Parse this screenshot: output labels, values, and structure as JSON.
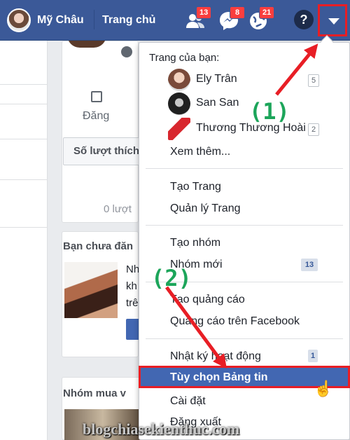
{
  "topbar": {
    "user_name": "Mỹ Châu",
    "home_label": "Trang chủ",
    "friend_requests_count": "13",
    "messages_count": "8",
    "notifications_count": "21",
    "help_glyph": "?",
    "bg_color": "#3b5998"
  },
  "feed": {
    "post_action": "Đăng",
    "stat_button": "Số lượt thích",
    "zero_likes": "0 lượt",
    "suggest_title": "Bạn chưa đăn",
    "suggest_lines": [
      "Nh",
      "kh",
      "trê"
    ],
    "group_title": "Nhóm mua v"
  },
  "menu": {
    "pages_header": "Trang của bạn:",
    "pages": [
      {
        "name": "Ely Trân",
        "count": "5"
      },
      {
        "name": "San San",
        "count": ""
      },
      {
        "name": "Thương Thương Hoài",
        "count": "2"
      }
    ],
    "see_more": "Xem thêm...",
    "create_page": "Tạo Trang",
    "manage_pages": "Quản lý Trang",
    "create_group": "Tạo nhóm",
    "new_groups": "Nhóm mới",
    "new_groups_count": "13",
    "create_ad": "Tạo quảng cáo",
    "fb_ads": "Quảng cáo trên Facebook",
    "activity_log": "Nhật ký hoạt động",
    "activity_log_count": "1",
    "news_feed_prefs": "Tùy chọn Bảng tin",
    "settings": "Cài đặt",
    "logout": "Đăng xuất"
  },
  "annotations": {
    "step1": "(1)",
    "step2": "(2)",
    "arrow_color": "#e81e25",
    "label_color": "#1ca55a"
  },
  "watermark": "blogchiasekienthuc.com"
}
